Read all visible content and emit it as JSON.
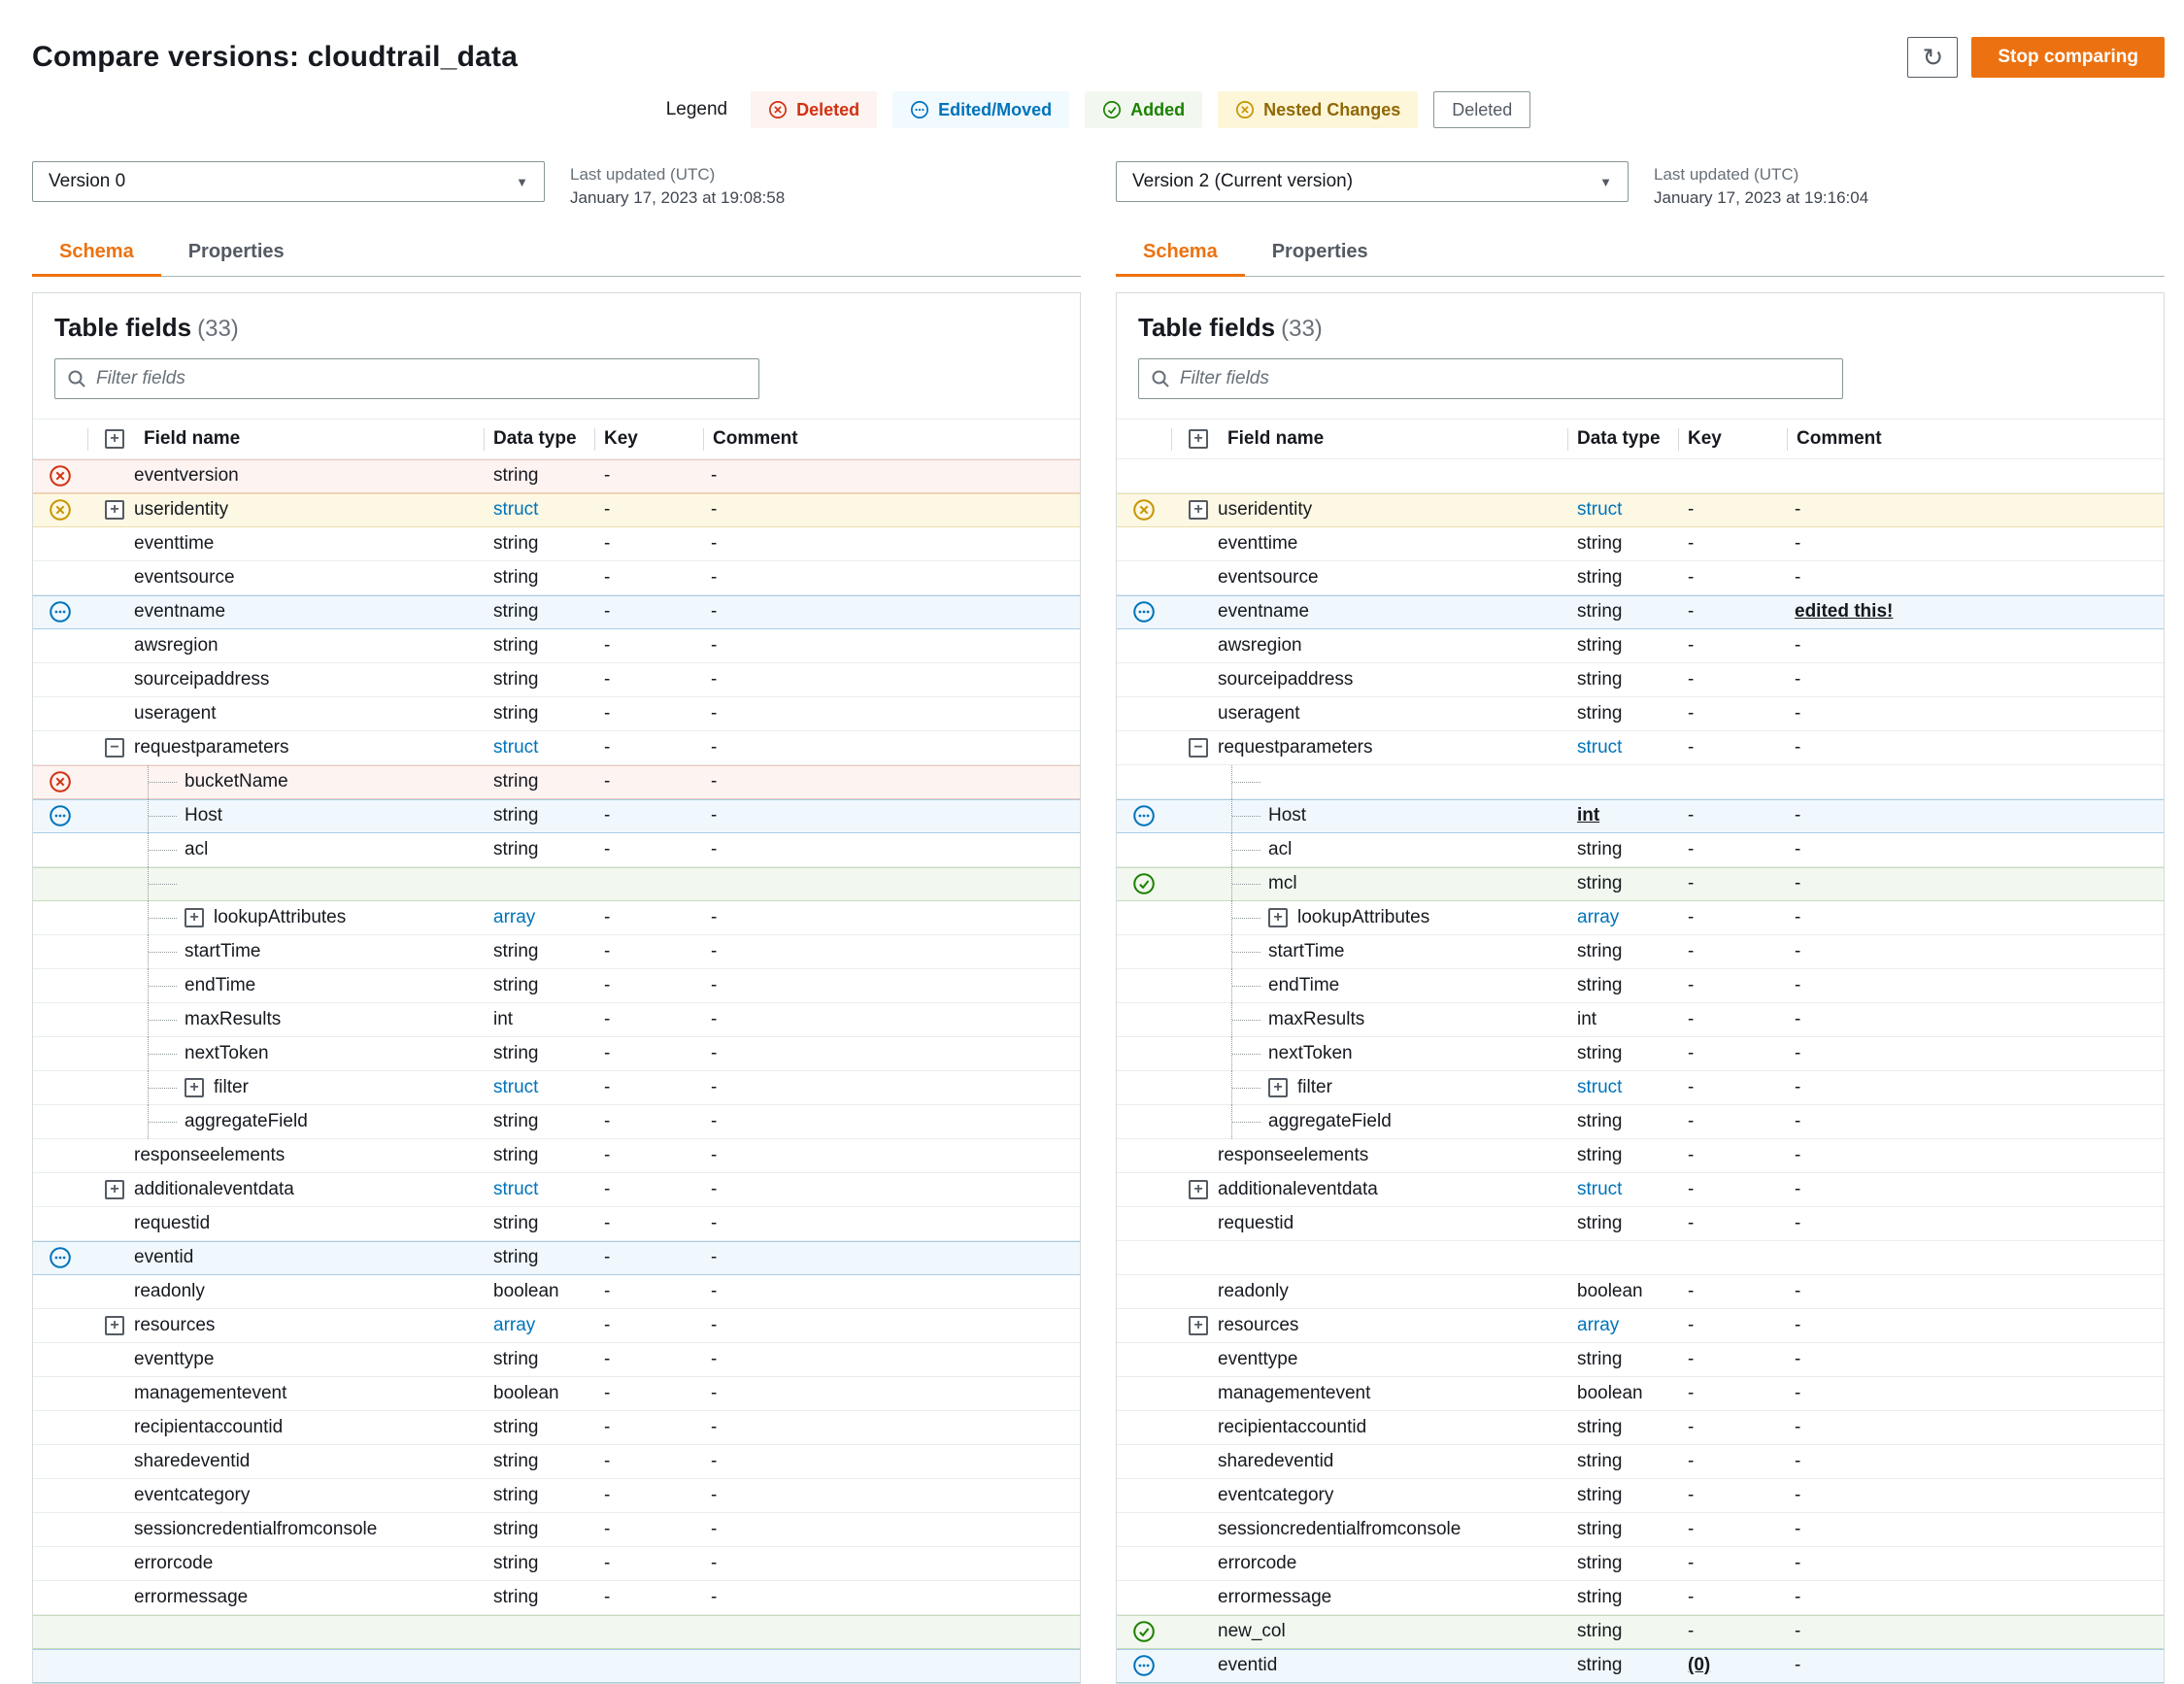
{
  "page": {
    "title": "Compare versions: cloudtrail_data",
    "stop_button": "Stop comparing",
    "refresh_icon": "↻"
  },
  "colors": {
    "accent": "#ec7211",
    "deleted": "#d13212",
    "edited": "#0073bb",
    "added": "#1d8102",
    "nested": "#c79500",
    "type_link": "#0073bb"
  },
  "legend": {
    "label": "Legend",
    "items": [
      {
        "label": "Deleted",
        "type": "deleted"
      },
      {
        "label": "Edited/Moved",
        "type": "edited"
      },
      {
        "label": "Added",
        "type": "added"
      },
      {
        "label": "Nested Changes",
        "type": "nested"
      },
      {
        "label": "Deleted",
        "type": "plain"
      }
    ]
  },
  "panels": [
    {
      "version_label": "Version 0",
      "updated_label": "Last updated (UTC)",
      "updated_value": "January 17, 2023 at 19:08:58",
      "tabs": [
        "Schema",
        "Properties"
      ],
      "active_tab": "Schema",
      "table_title": "Table fields",
      "table_count": "(33)",
      "filter_placeholder": "Filter fields",
      "columns": [
        "Field name",
        "Data type",
        "Key",
        "Comment"
      ],
      "rows": [
        {
          "name": "eventversion",
          "type": "string",
          "key": "-",
          "comment": "-",
          "status": "deleted"
        },
        {
          "name": "useridentity",
          "type": "struct",
          "type_link": true,
          "key": "-",
          "comment": "-",
          "status": "nested",
          "expand": "plus"
        },
        {
          "name": "eventtime",
          "type": "string",
          "key": "-",
          "comment": "-"
        },
        {
          "name": "eventsource",
          "type": "string",
          "key": "-",
          "comment": "-"
        },
        {
          "name": "eventname",
          "type": "string",
          "key": "-",
          "comment": "-",
          "status": "edited"
        },
        {
          "name": "awsregion",
          "type": "string",
          "key": "-",
          "comment": "-"
        },
        {
          "name": "sourceipaddress",
          "type": "string",
          "key": "-",
          "comment": "-"
        },
        {
          "name": "useragent",
          "type": "string",
          "key": "-",
          "comment": "-"
        },
        {
          "name": "requestparameters",
          "type": "struct",
          "type_link": true,
          "key": "-",
          "comment": "-",
          "expand": "minus"
        },
        {
          "name": "bucketName",
          "type": "string",
          "key": "-",
          "comment": "-",
          "status": "deleted",
          "indent": 1
        },
        {
          "name": "Host",
          "type": "string",
          "key": "-",
          "comment": "-",
          "status": "edited",
          "indent": 1
        },
        {
          "name": "acl",
          "type": "string",
          "key": "-",
          "comment": "-",
          "indent": 1
        },
        {
          "empty": true,
          "status": "added",
          "indent": 1,
          "dotted": true
        },
        {
          "name": "lookupAttributes",
          "type": "array",
          "type_link": true,
          "key": "-",
          "comment": "-",
          "indent": 1,
          "expand": "plus"
        },
        {
          "name": "startTime",
          "type": "string",
          "key": "-",
          "comment": "-",
          "indent": 1
        },
        {
          "name": "endTime",
          "type": "string",
          "key": "-",
          "comment": "-",
          "indent": 1
        },
        {
          "name": "maxResults",
          "type": "int",
          "key": "-",
          "comment": "-",
          "indent": 1
        },
        {
          "name": "nextToken",
          "type": "string",
          "key": "-",
          "comment": "-",
          "indent": 1
        },
        {
          "name": "filter",
          "type": "struct",
          "type_link": true,
          "key": "-",
          "comment": "-",
          "indent": 1,
          "expand": "plus"
        },
        {
          "name": "aggregateField",
          "type": "string",
          "key": "-",
          "comment": "-",
          "indent": 1
        },
        {
          "name": "responseelements",
          "type": "string",
          "key": "-",
          "comment": "-"
        },
        {
          "name": "additionaleventdata",
          "type": "struct",
          "type_link": true,
          "key": "-",
          "comment": "-",
          "expand": "plus"
        },
        {
          "name": "requestid",
          "type": "string",
          "key": "-",
          "comment": "-"
        },
        {
          "name": "eventid",
          "type": "string",
          "key": "-",
          "comment": "-",
          "status": "edited"
        },
        {
          "name": "readonly",
          "type": "boolean",
          "key": "-",
          "comment": "-"
        },
        {
          "name": "resources",
          "type": "array",
          "type_link": true,
          "key": "-",
          "comment": "-",
          "expand": "plus"
        },
        {
          "name": "eventtype",
          "type": "string",
          "key": "-",
          "comment": "-"
        },
        {
          "name": "managementevent",
          "type": "boolean",
          "key": "-",
          "comment": "-"
        },
        {
          "name": "recipientaccountid",
          "type": "string",
          "key": "-",
          "comment": "-"
        },
        {
          "name": "sharedeventid",
          "type": "string",
          "key": "-",
          "comment": "-"
        },
        {
          "name": "eventcategory",
          "type": "string",
          "key": "-",
          "comment": "-"
        },
        {
          "name": "sessioncredentialfromconsole",
          "type": "string",
          "key": "-",
          "comment": "-"
        },
        {
          "name": "errorcode",
          "type": "string",
          "key": "-",
          "comment": "-"
        },
        {
          "name": "errormessage",
          "type": "string",
          "key": "-",
          "comment": "-"
        },
        {
          "empty": true,
          "status": "added"
        },
        {
          "empty": true,
          "status": "edited"
        }
      ]
    },
    {
      "version_label": "Version 2 (Current version)",
      "updated_label": "Last updated (UTC)",
      "updated_value": "January 17, 2023 at 19:16:04",
      "tabs": [
        "Schema",
        "Properties"
      ],
      "active_tab": "Schema",
      "table_title": "Table fields",
      "table_count": "(33)",
      "filter_placeholder": "Filter fields",
      "columns": [
        "Field name",
        "Data type",
        "Key",
        "Comment"
      ],
      "rows": [
        {
          "empty": true
        },
        {
          "name": "useridentity",
          "type": "struct",
          "type_link": true,
          "key": "-",
          "comment": "-",
          "status": "nested",
          "expand": "plus"
        },
        {
          "name": "eventtime",
          "type": "string",
          "key": "-",
          "comment": "-"
        },
        {
          "name": "eventsource",
          "type": "string",
          "key": "-",
          "comment": "-"
        },
        {
          "name": "eventname",
          "type": "string",
          "key": "-",
          "comment": "edited this!",
          "status": "edited",
          "comment_em": true
        },
        {
          "name": "awsregion",
          "type": "string",
          "key": "-",
          "comment": "-"
        },
        {
          "name": "sourceipaddress",
          "type": "string",
          "key": "-",
          "comment": "-"
        },
        {
          "name": "useragent",
          "type": "string",
          "key": "-",
          "comment": "-"
        },
        {
          "name": "requestparameters",
          "type": "struct",
          "type_link": true,
          "key": "-",
          "comment": "-",
          "expand": "minus"
        },
        {
          "empty": true,
          "indent": 1,
          "dotted": true
        },
        {
          "name": "Host",
          "type": "int",
          "key": "-",
          "comment": "-",
          "status": "edited",
          "indent": 1,
          "type_em": true
        },
        {
          "name": "acl",
          "type": "string",
          "key": "-",
          "comment": "-",
          "indent": 1
        },
        {
          "name": "mcl",
          "type": "string",
          "key": "-",
          "comment": "-",
          "status": "added",
          "indent": 1
        },
        {
          "name": "lookupAttributes",
          "type": "array",
          "type_link": true,
          "key": "-",
          "comment": "-",
          "indent": 1,
          "expand": "plus"
        },
        {
          "name": "startTime",
          "type": "string",
          "key": "-",
          "comment": "-",
          "indent": 1
        },
        {
          "name": "endTime",
          "type": "string",
          "key": "-",
          "comment": "-",
          "indent": 1
        },
        {
          "name": "maxResults",
          "type": "int",
          "key": "-",
          "comment": "-",
          "indent": 1
        },
        {
          "name": "nextToken",
          "type": "string",
          "key": "-",
          "comment": "-",
          "indent": 1
        },
        {
          "name": "filter",
          "type": "struct",
          "type_link": true,
          "key": "-",
          "comment": "-",
          "indent": 1,
          "expand": "plus"
        },
        {
          "name": "aggregateField",
          "type": "string",
          "key": "-",
          "comment": "-",
          "indent": 1
        },
        {
          "name": "responseelements",
          "type": "string",
          "key": "-",
          "comment": "-"
        },
        {
          "name": "additionaleventdata",
          "type": "struct",
          "type_link": true,
          "key": "-",
          "comment": "-",
          "expand": "plus"
        },
        {
          "name": "requestid",
          "type": "string",
          "key": "-",
          "comment": "-"
        },
        {
          "empty": true
        },
        {
          "name": "readonly",
          "type": "boolean",
          "key": "-",
          "comment": "-"
        },
        {
          "name": "resources",
          "type": "array",
          "type_link": true,
          "key": "-",
          "comment": "-",
          "expand": "plus"
        },
        {
          "name": "eventtype",
          "type": "string",
          "key": "-",
          "comment": "-"
        },
        {
          "name": "managementevent",
          "type": "boolean",
          "key": "-",
          "comment": "-"
        },
        {
          "name": "recipientaccountid",
          "type": "string",
          "key": "-",
          "comment": "-"
        },
        {
          "name": "sharedeventid",
          "type": "string",
          "key": "-",
          "comment": "-"
        },
        {
          "name": "eventcategory",
          "type": "string",
          "key": "-",
          "comment": "-"
        },
        {
          "name": "sessioncredentialfromconsole",
          "type": "string",
          "key": "-",
          "comment": "-"
        },
        {
          "name": "errorcode",
          "type": "string",
          "key": "-",
          "comment": "-"
        },
        {
          "name": "errormessage",
          "type": "string",
          "key": "-",
          "comment": "-"
        },
        {
          "name": "new_col",
          "type": "string",
          "key": "-",
          "comment": "-",
          "status": "added"
        },
        {
          "name": "eventid",
          "type": "string",
          "key": "(0)",
          "comment": "-",
          "status": "edited",
          "key_em": true
        }
      ]
    }
  ]
}
